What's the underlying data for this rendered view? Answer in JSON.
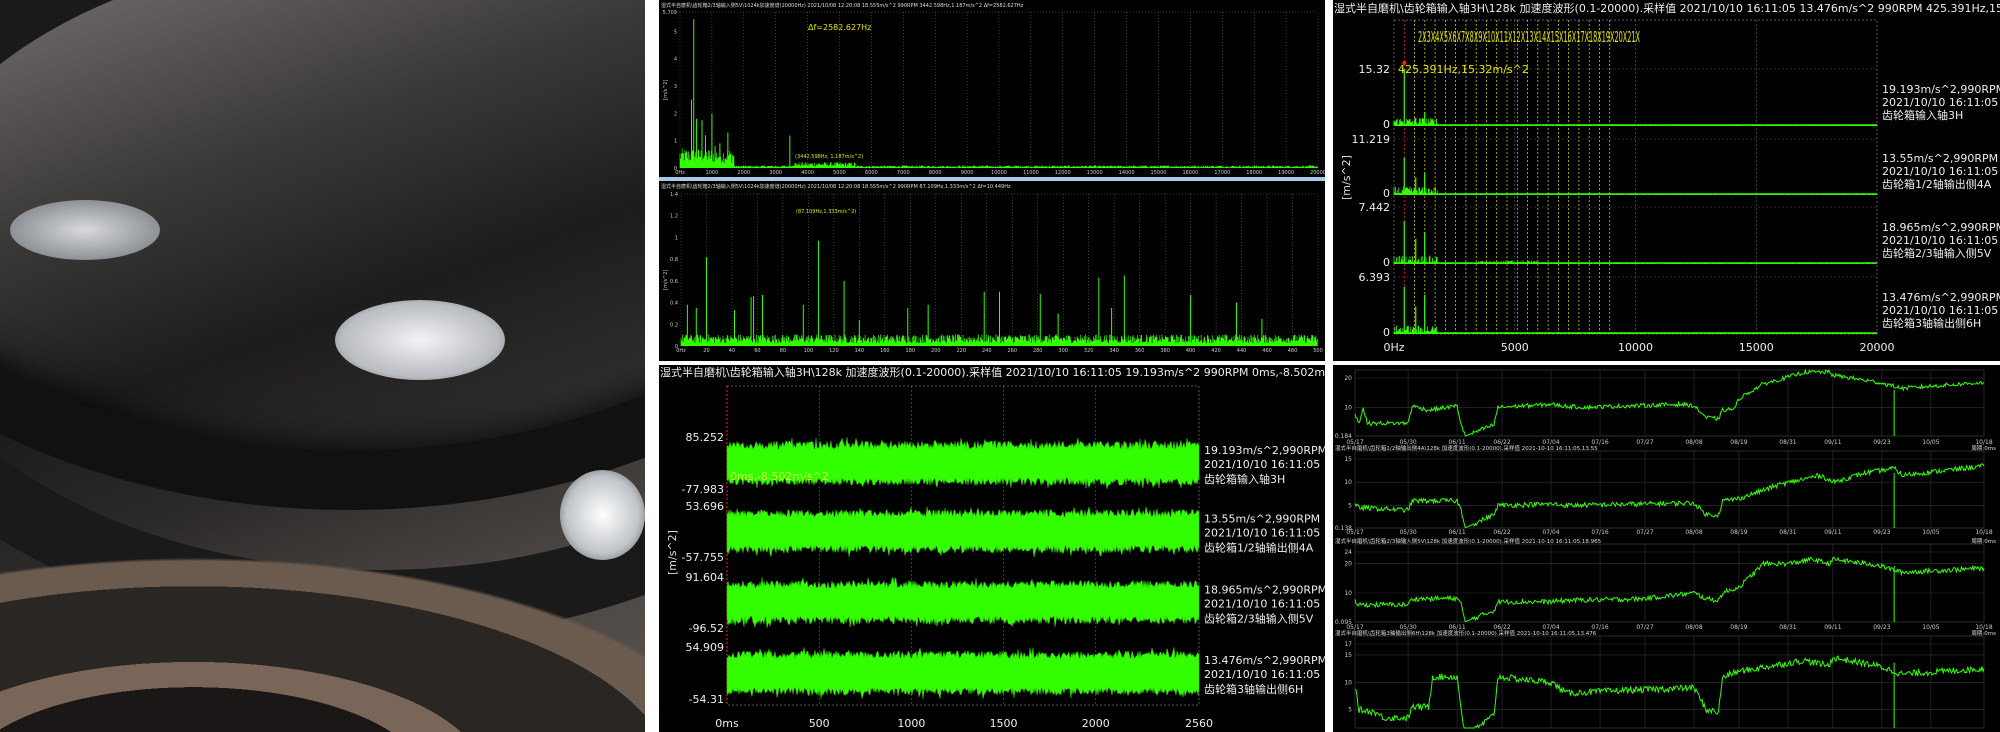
{
  "photo": {
    "label": "bearing-photo"
  },
  "colors": {
    "trace": "#33ff00",
    "harmonic": "#e6e600",
    "cursor": "#ff2020",
    "grid": "#555555",
    "text": "#e8e8e8"
  },
  "top_middle": {
    "spectrum_full": {
      "header": "湿式半自磨机\\齿轮箱2/3轴输入侧5V\\1024k加速度谱(20000Hz)    2021/10/08 12:20:08    18.555m/s^2    990RPM    3442.598Hz,1.187m/s^2    Δf=2582.627Hz",
      "delta": "Δf=2582.627Hz",
      "cursor": "(3442.598Hz, 1.187m/s^2)",
      "ylabel": "[m/s^2]"
    },
    "spectrum_zoom": {
      "header": "湿式半自磨机\\齿轮箱2/3轴输入侧5V\\1024k加速度谱(20000Hz)    2021/10/08 12:20:08    18.555m/s^2    990RPM    87.109Hz,1.333m/s^2    Δf=10.449Hz",
      "cursor": "(87.109Hz,1.333m/s^2)",
      "ylabel": "[m/s^2]"
    }
  },
  "top_right": {
    "header": "湿式半自磨机\\齿轮箱输入轴3H\\128k 加速度波形(0.1-20000).采样值     2021/10/10 16:11:05     13.476m/s^2     990RPM     425.391Hz,15.32m/s^2",
    "harmonics": "2X3X4X5X6X7X8X9X10X11X12X13X14X15X16X17X18X19X20X21X",
    "cursor": "425.391Hz,15.32m/s^2",
    "ylabel": "[m/s^2]"
  },
  "bottom_middle": {
    "header": "湿式半自磨机\\齿轮箱输入轴3H\\128k 加速度波形(0.1-20000).采样值     2021/10/10 16:11:05     19.193m/s^2     990RPM     0ms,-8.502m/s^2",
    "cursor": "0ms,-8.502m/s^2",
    "ylabel": "[m/s^2]"
  },
  "bottom_right": {
    "period": "周期:0ms"
  },
  "chart_data": [
    {
      "id": "spectrum_full",
      "type": "bar",
      "title": "加速度谱(20000Hz)",
      "xlim": [
        0,
        20000
      ],
      "ylim": [
        0,
        5.709
      ],
      "x_ticks": [
        "0Hz",
        "1000",
        "2000",
        "3000",
        "4000",
        "5000",
        "6000",
        "7000",
        "8000",
        "9000",
        "10000",
        "11000",
        "12000",
        "13000",
        "14000",
        "15000",
        "16000",
        "17000",
        "18000",
        "19000",
        "20000"
      ],
      "y_ticks": [
        "0",
        "1",
        "2",
        "3",
        "4",
        "5",
        "5.709"
      ],
      "peaks": [
        [
          360,
          2.5
        ],
        [
          430,
          5.45
        ],
        [
          520,
          1.8
        ],
        [
          690,
          1.75
        ],
        [
          800,
          1.2
        ],
        [
          1000,
          2.0
        ],
        [
          1100,
          0.8
        ],
        [
          1250,
          0.9
        ],
        [
          1500,
          1.3
        ],
        [
          3442.598,
          1.187
        ]
      ]
    },
    {
      "id": "spectrum_zoom",
      "type": "bar",
      "title": "加速度谱(0-500Hz)",
      "xlim": [
        0,
        500
      ],
      "ylim": [
        0,
        1.4
      ],
      "x_ticks": [
        "0Hz",
        "20",
        "40",
        "60",
        "80",
        "100",
        "120",
        "140",
        "160",
        "180",
        "200",
        "220",
        "240",
        "260",
        "280",
        "300",
        "320",
        "340",
        "360",
        "380",
        "400",
        "420",
        "440",
        "460",
        "480",
        "500"
      ],
      "y_ticks": [
        "0",
        "0.2",
        "0.4",
        "0.6",
        "0.8",
        "1",
        "1.2",
        "1.4"
      ],
      "peaks": [
        [
          5,
          0.38
        ],
        [
          12,
          0.35
        ],
        [
          20,
          0.82
        ],
        [
          42,
          0.33
        ],
        [
          55,
          0.45
        ],
        [
          57,
          0.46
        ],
        [
          64,
          0.47
        ],
        [
          96,
          0.38
        ],
        [
          108,
          0.97
        ],
        [
          128,
          0.6
        ],
        [
          140,
          0.24
        ],
        [
          178,
          0.35
        ],
        [
          194,
          0.38
        ],
        [
          238,
          0.5
        ],
        [
          250,
          0.5
        ],
        [
          282,
          0.48
        ],
        [
          296,
          0.3
        ],
        [
          328,
          0.63
        ],
        [
          338,
          0.35
        ],
        [
          348,
          0.65
        ],
        [
          400,
          0.47
        ],
        [
          436,
          0.4
        ],
        [
          456,
          0.25
        ]
      ]
    },
    {
      "id": "multi_spectrum",
      "type": "line",
      "title": "齿轮箱加速度谱 4通道",
      "xlim": [
        0,
        20000
      ],
      "x_ticks": [
        "0Hz",
        "5000",
        "10000",
        "15000",
        "20000"
      ],
      "fundamental_hz": 425.391,
      "harmonic_count": 21,
      "series": [
        {
          "name": "齿轮箱输入轴3H",
          "ymax_label": "15.32",
          "ymax": 15.32,
          "zero_label": "0",
          "rms": "19.193m/s^2,990RPM",
          "time": "2021/10/10 16:11:05",
          "peaks": [
            [
              425.391,
              15.32
            ],
            [
              900,
              2.2
            ],
            [
              1270,
              3.8
            ]
          ]
        },
        {
          "name": "齿轮箱1/2轴输出侧4A",
          "ymax_label": "11.219",
          "ymax": 11.219,
          "zero_label": "0",
          "rms": "13.55m/s^2,990RPM",
          "time": "2021/10/10 16:11:05",
          "peaks": [
            [
              425.391,
              7.5
            ],
            [
              900,
              3.5
            ],
            [
              1270,
              4.5
            ]
          ]
        },
        {
          "name": "齿轮箱2/3轴输入侧5V",
          "ymax_label": "7.442",
          "ymax": 7.442,
          "zero_label": "0",
          "rms": "18.965m/s^2,990RPM",
          "time": "2021/10/10 16:11:05",
          "peaks": [
            [
              425.391,
              5.6
            ],
            [
              900,
              3.3
            ],
            [
              1270,
              4.2
            ]
          ]
        },
        {
          "name": "齿轮箱3轴输出侧6H",
          "ymax_label": "6.393",
          "ymax": 6.393,
          "zero_label": "0",
          "rms": "13.476m/s^2,990RPM",
          "time": "2021/10/10 16:11:05",
          "peaks": [
            [
              425.391,
              5.3
            ],
            [
              900,
              3.1
            ],
            [
              1270,
              4.4
            ]
          ]
        }
      ]
    },
    {
      "id": "waveform",
      "type": "line",
      "title": "加速度波形(0.1-20000)",
      "xlim": [
        0,
        2560
      ],
      "x_ticks": [
        "0ms",
        "500",
        "1000",
        "1500",
        "2000",
        "2560"
      ],
      "series": [
        {
          "name": "齿轮箱输入轴3H",
          "ymax_label": "85.252",
          "ymin_label": "-77.983",
          "ymax": 85.252,
          "ymin": -77.983,
          "rms": "19.193m/s^2,990RPM",
          "time": "2021/10/10 16:11:05"
        },
        {
          "name": "齿轮箱1/2轴输出侧4A",
          "ymax_label": "53.696",
          "ymin_label": "-57.755",
          "ymax": 53.696,
          "ymin": -57.755,
          "rms": "13.55m/s^2,990RPM",
          "time": "2021/10/10 16:11:05"
        },
        {
          "name": "齿轮箱2/3轴输入侧5V",
          "ymax_label": "91.604",
          "ymin_label": "-96.52",
          "ymax": 91.604,
          "ymin": -96.52,
          "rms": "18.965m/s^2,990RPM",
          "time": "2021/10/10 16:11:05"
        },
        {
          "name": "齿轮箱3轴输出侧6H",
          "ymax_label": "54.909",
          "ymin_label": "-54.31",
          "ymax": 54.909,
          "ymin": -54.31,
          "rms": "13.476m/s^2,990RPM",
          "time": "2021/10/10 16:11:05"
        }
      ]
    },
    {
      "id": "trends",
      "type": "line",
      "title": "加速度有效值趋势",
      "x_ticks": [
        "05/17",
        "05/30",
        "06/11",
        "06/22",
        "07/04",
        "07/16",
        "07/27",
        "08/08",
        "08/19",
        "08/31",
        "09/11",
        "09/23",
        "10/05",
        "10/18"
      ],
      "x_unit": "days since 05/17",
      "x_tick_days": [
        0,
        13,
        25,
        36,
        48,
        60,
        71,
        83,
        94,
        106,
        117,
        129,
        141,
        154
      ],
      "series": [
        {
          "name": "齿轮箱输入轴3H",
          "header": "",
          "ylim": [
            0.184,
            20
          ],
          "y_ticks": [
            "0.184",
            "10",
            "20"
          ],
          "y_tick_values": [
            0.184,
            10,
            20
          ],
          "points": [
            [
              0,
              8
            ],
            [
              1,
              4.5
            ],
            [
              2,
              10
            ],
            [
              3,
              4.5
            ],
            [
              13,
              4.6
            ],
            [
              14,
              10.5
            ],
            [
              18,
              9
            ],
            [
              25,
              10.5
            ],
            [
              26,
              4
            ],
            [
              27,
              0.2
            ],
            [
              34,
              4
            ],
            [
              35,
              10
            ],
            [
              48,
              11
            ],
            [
              52,
              10.3
            ],
            [
              56,
              10
            ],
            [
              80,
              11
            ],
            [
              83,
              10.5
            ],
            [
              86,
              6.5
            ],
            [
              89,
              6
            ],
            [
              90,
              9
            ],
            [
              93,
              9.5
            ],
            [
              94,
              13
            ],
            [
              100,
              18
            ],
            [
              104,
              19.5
            ],
            [
              110,
              22
            ],
            [
              116,
              22
            ],
            [
              117,
              21
            ],
            [
              128,
              18.5
            ],
            [
              134,
              16.5
            ],
            [
              154,
              18.5
            ]
          ]
        },
        {
          "name": "齿轮箱1/2轴输出侧4A",
          "header": "湿式半自磨机\\齿轮箱1/2轴输出侧4A\\128k 加速度波形(0.1-20000).采样值        2021-10-10 16:11:05,13.55",
          "ylim": [
            0.138,
            15
          ],
          "y_ticks": [
            "0.138",
            "5",
            "10",
            "15"
          ],
          "y_tick_values": [
            0.138,
            5,
            10,
            15
          ],
          "points": [
            [
              0,
              5
            ],
            [
              1,
              4.5
            ],
            [
              13,
              4
            ],
            [
              14,
              6
            ],
            [
              25,
              6
            ],
            [
              26,
              4
            ],
            [
              27,
              0.2
            ],
            [
              34,
              3
            ],
            [
              35,
              5
            ],
            [
              48,
              5.3
            ],
            [
              52,
              5
            ],
            [
              80,
              5.5
            ],
            [
              83,
              5.5
            ],
            [
              86,
              3
            ],
            [
              89,
              3
            ],
            [
              90,
              6
            ],
            [
              94,
              6.5
            ],
            [
              104,
              9.5
            ],
            [
              114,
              11.5
            ],
            [
              116,
              10.5
            ],
            [
              117,
              10
            ],
            [
              125,
              12
            ],
            [
              132,
              13
            ],
            [
              134,
              11.5
            ],
            [
              154,
              13.5
            ]
          ]
        },
        {
          "name": "齿轮箱2/3轴输入侧5V",
          "header": "湿式半自磨机\\齿轮箱2/3轴输入侧5V\\128k 加速度波形(0.1-20000).采样值        2021-10-10 16:11:05,18.965",
          "ylim": [
            0.095,
            24
          ],
          "y_ticks": [
            "0.095",
            "10",
            "20",
            "24"
          ],
          "y_tick_values": [
            0.095,
            10,
            20,
            24
          ],
          "points": [
            [
              0,
              7
            ],
            [
              1,
              6
            ],
            [
              13,
              6
            ],
            [
              14,
              8
            ],
            [
              25,
              8.2
            ],
            [
              26,
              6
            ],
            [
              27,
              0.2
            ],
            [
              34,
              4
            ],
            [
              35,
              7
            ],
            [
              48,
              7
            ],
            [
              52,
              7.5
            ],
            [
              70,
              8
            ],
            [
              83,
              10
            ],
            [
              86,
              8
            ],
            [
              89,
              7.5
            ],
            [
              90,
              10
            ],
            [
              94,
              12
            ],
            [
              100,
              20
            ],
            [
              106,
              20
            ],
            [
              112,
              21.5
            ],
            [
              116,
              20
            ],
            [
              117,
              21.5
            ],
            [
              128,
              19.5
            ],
            [
              134,
              17
            ],
            [
              154,
              18.5
            ]
          ]
        },
        {
          "name": "齿轮箱3轴输出侧6H",
          "header": "湿式半自磨机\\齿轮箱3轴输出侧6H\\128k 加速度波形(0.1-20000).采样值        2021-10-10 16:11:05,13.476",
          "ylim": [
            0,
            17
          ],
          "y_ticks": [
            "5",
            "10",
            "15",
            "17"
          ],
          "y_tick_values": [
            5,
            10,
            15,
            17
          ],
          "points": [
            [
              0,
              9
            ],
            [
              1,
              5
            ],
            [
              5,
              4.5
            ],
            [
              7,
              3.5
            ],
            [
              13,
              3.5
            ],
            [
              14,
              5.5
            ],
            [
              18,
              5.5
            ],
            [
              19,
              11
            ],
            [
              25,
              11
            ],
            [
              26,
              5
            ],
            [
              27,
              0
            ],
            [
              34,
              4
            ],
            [
              35,
              11
            ],
            [
              48,
              10
            ],
            [
              52,
              8
            ],
            [
              65,
              8.5
            ],
            [
              83,
              9
            ],
            [
              86,
              5
            ],
            [
              89,
              4.5
            ],
            [
              90,
              11
            ],
            [
              94,
              12
            ],
            [
              110,
              14
            ],
            [
              116,
              13
            ],
            [
              117,
              14.5
            ],
            [
              128,
              13
            ],
            [
              134,
              11.5
            ],
            [
              154,
              12.5
            ]
          ]
        }
      ]
    }
  ]
}
